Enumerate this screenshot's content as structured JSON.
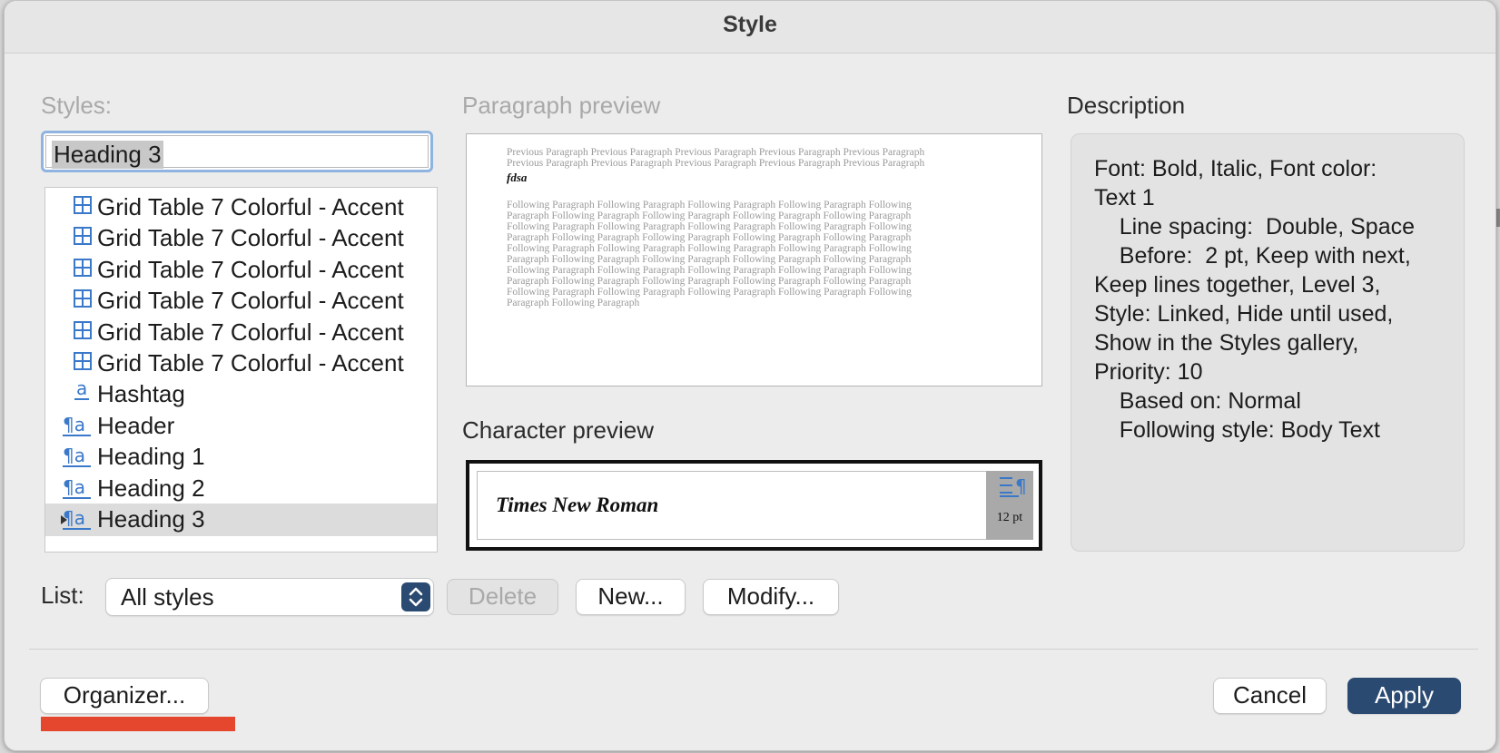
{
  "window": {
    "title": "Style"
  },
  "labels": {
    "styles": "Styles:",
    "paragraph_preview": "Paragraph preview",
    "character_preview": "Character preview",
    "description": "Description",
    "list": "List:"
  },
  "style_name_value": "Heading 3",
  "style_list": [
    {
      "icon": "table-style-icon",
      "label": "Grid Table 7 Colorful - Accent",
      "selected": false
    },
    {
      "icon": "table-style-icon",
      "label": "Grid Table 7 Colorful - Accent",
      "selected": false
    },
    {
      "icon": "table-style-icon",
      "label": "Grid Table 7 Colorful - Accent",
      "selected": false
    },
    {
      "icon": "table-style-icon",
      "label": "Grid Table 7 Colorful - Accent",
      "selected": false
    },
    {
      "icon": "table-style-icon",
      "label": "Grid Table 7 Colorful - Accent",
      "selected": false
    },
    {
      "icon": "table-style-icon",
      "label": "Grid Table 7 Colorful - Accent",
      "selected": false
    },
    {
      "icon": "character-style-icon",
      "label": "Hashtag",
      "selected": false
    },
    {
      "icon": "linked-style-icon",
      "label": "Header",
      "selected": false
    },
    {
      "icon": "linked-style-icon",
      "label": "Heading 1",
      "selected": false
    },
    {
      "icon": "linked-style-icon",
      "label": "Heading 2",
      "selected": false
    },
    {
      "icon": "linked-style-icon",
      "label": "Heading 3",
      "selected": true
    }
  ],
  "paragraph_preview": {
    "previous_text": "Previous Paragraph Previous Paragraph Previous Paragraph Previous Paragraph Previous Paragraph Previous Paragraph Previous Paragraph Previous Paragraph Previous Paragraph Previous Paragraph",
    "current_text": "fdsa",
    "following_text": "Following Paragraph Following Paragraph Following Paragraph Following Paragraph Following Paragraph Following Paragraph Following Paragraph Following Paragraph Following Paragraph Following Paragraph Following Paragraph Following Paragraph Following Paragraph Following Paragraph Following Paragraph Following Paragraph Following Paragraph Following Paragraph Following Paragraph Following Paragraph Following Paragraph Following Paragraph Following Paragraph Following Paragraph Following Paragraph Following Paragraph Following Paragraph Following Paragraph Following Paragraph Following Paragraph Following Paragraph Following Paragraph Following Paragraph Following Paragraph Following Paragraph Following Paragraph Following Paragraph Following Paragraph Following Paragraph Following Paragraph Following Paragraph Following Paragraph"
  },
  "character_preview": {
    "font_name": "Times New Roman",
    "size": "12 pt",
    "icon": "paragraph-spacing-icon"
  },
  "description_lines": [
    "Font: Bold, Italic, Font color:",
    "Text 1",
    "    Line spacing:  Double, Space",
    "    Before:  2 pt, Keep with next,",
    "Keep lines together, Level 3,",
    "Style: Linked, Hide until used,",
    "Show in the Styles gallery,",
    "Priority: 10",
    "    Based on: Normal",
    "    Following style: Body Text"
  ],
  "list_select": {
    "value": "All styles",
    "icon": "up-down-chevron-icon"
  },
  "buttons": {
    "delete": "Delete",
    "new": "New...",
    "modify": "Modify...",
    "organizer": "Organizer...",
    "cancel": "Cancel",
    "apply": "Apply"
  },
  "colors": {
    "accent": "#2b4a72",
    "icon_blue": "#3a78c9",
    "annotation_red": "#e5472e"
  }
}
